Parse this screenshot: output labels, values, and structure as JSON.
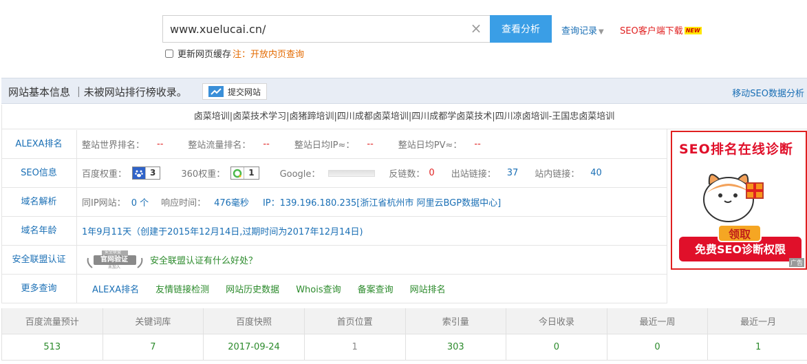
{
  "search": {
    "value": "www.xuelucai.cn/",
    "button_label": "查看分析"
  },
  "links": {
    "history": "查询记录",
    "client_download": "SEO客户端下载",
    "new_badge": "NEW"
  },
  "cache": {
    "label": "更新网页缓存",
    "note": "注：开放内页查询"
  },
  "info_bar": {
    "title": "网站基本信息 ｜未被网站排行榜收录。",
    "submit_label": "提交网站",
    "mobile_link": "移动SEO数据分析"
  },
  "keywords": "卤菜培训|卤菜技术学习|卤猪蹄培训|四川成都卤菜培训|四川成都学卤菜技术|四川凉卤培训-王国忠卤菜培训",
  "rows": {
    "alexa": {
      "label": "ALEXA排名",
      "world_label": "整站世界排名：",
      "world_value": "--",
      "traffic_label": "整站流量排名：",
      "traffic_value": "--",
      "ip_label": "整站日均IP≈：",
      "ip_value": "--",
      "pv_label": "整站日均PV≈：",
      "pv_value": "--"
    },
    "seo": {
      "label": "SEO信息",
      "baidu_label": "百度权重：",
      "baidu_value": "3",
      "so360_label": "360权重：",
      "so360_value": "1",
      "google_label": "Google：",
      "backlinks_label": "反链数：",
      "backlinks_value": "0",
      "outlinks_label": "出站链接：",
      "outlinks_value": "37",
      "inlinks_label": "站内链接：",
      "inlinks_value": "40"
    },
    "domain": {
      "label": "域名解析",
      "sameip_label": "同IP网站：",
      "sameip_value": "0 个",
      "resp_label": "响应时间：",
      "resp_value": "476毫秒",
      "ip_text": "IP：139.196.180.235[浙江省杭州市 阿里云BGP数据中心]"
    },
    "age": {
      "label": "域名年龄",
      "value": "1年9月11天（创建于2015年12月14日,过期时间为2017年12月14日)"
    },
    "security": {
      "label": "安全联盟认证",
      "seal_top": "安全联盟",
      "seal_main": "官网验证",
      "seal_sub": "未加入",
      "link": "安全联盟认证有什么好处？"
    },
    "more": {
      "label": "更多查询",
      "items": [
        "ALEXA排名",
        "友情链接检测",
        "网站历史数据",
        "Whois查询",
        "备案查询",
        "网站排名"
      ]
    }
  },
  "ad": {
    "title": "SEO排名在线诊断",
    "small_btn": "领取",
    "big_btn": "免费SEO诊断权限",
    "mark": "广告"
  },
  "stats": {
    "headers": [
      "百度流量预计",
      "关键词库",
      "百度快照",
      "首页位置",
      "索引量",
      "今日收录",
      "最近一周",
      "最近一月"
    ],
    "values": [
      "513",
      "7",
      "2017-09-24",
      "1",
      "303",
      "0",
      "0",
      "1"
    ]
  },
  "colors": {
    "accent_blue": "#3a9ee6",
    "link_blue": "#1a6fb5",
    "red": "#e02020",
    "green": "#2b8a2b"
  }
}
